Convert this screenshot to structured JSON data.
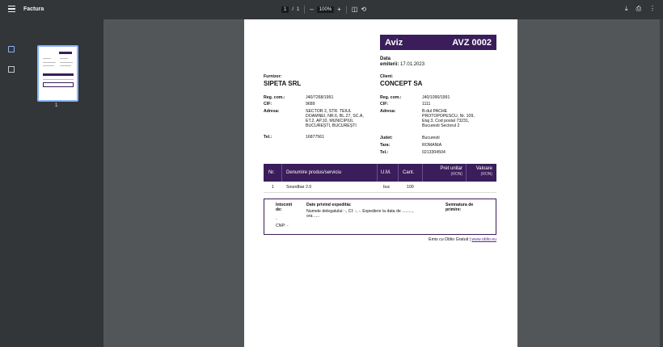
{
  "toolbar": {
    "title": "Factura",
    "page_current": "1",
    "page_separator": "/",
    "page_total": "1",
    "zoom": "100%",
    "zoom_out": "–",
    "zoom_in": "+"
  },
  "sidebar": {
    "thumb_page": "1"
  },
  "doc": {
    "doc_type": "Aviz",
    "doc_number": "AVZ 0002",
    "date_label": "Data",
    "date_label2": "emiterii:",
    "date_value": "17.01.2023",
    "supplier_label": "Furnizor:",
    "supplier_name": "SIPETA SRL",
    "client_label": "Client:",
    "client_name": "CONCEPT SA",
    "supplier": {
      "reg_label": "Reg. com.:",
      "reg": "J40/7268/1991",
      "cif_label": "CIF:",
      "cif": "9689",
      "addr_label": "Adresa:",
      "addr1": "SECTOR 2, STR. TEIUL",
      "addr2": "DOAMNEI, NR.6, BL.27, SC.A,",
      "addr3": "ET.2, AP.10, MUNICIPIUL",
      "addr4": "BUCUREȘTI, BUCUREȘTI",
      "tel_label": "Tel.:",
      "tel": "16877561"
    },
    "client": {
      "reg_label": "Reg. com.:",
      "reg": "J40/1090/1991",
      "cif_label": "CIF:",
      "cif": "1111",
      "addr_label": "Adresa:",
      "addr1": "B-dul PACHE",
      "addr2": "PROTOPOPESCU, Nr. 109,",
      "addr3": "Etaj 3, Cod postal 73231,",
      "addr4": "Bucuresti Sectorul 2",
      "county_label": "Judet:",
      "county": "Bucuresti",
      "country_label": "Tara:",
      "country": "ROMANIA",
      "tel_label": "Tel.:",
      "tel": "0213304504"
    },
    "table": {
      "h_nr": "Nr.",
      "h_name": "Denumire produs/serviciu",
      "h_um": "U.M.",
      "h_qty": "Cant.",
      "h_price": "Pret unitar",
      "h_price_sub": "(RON)",
      "h_value": "Valoare",
      "h_value_sub": "(RON)",
      "rows": [
        {
          "nr": "1",
          "name": "Soundbar 2.0",
          "um": "buc",
          "qty": "100"
        }
      ]
    },
    "expedition": {
      "made_label1": "Intocmit",
      "made_label2": "de:",
      "made_dash": "-",
      "cnp": "CNP: -",
      "data_label": "Date privind expeditia:",
      "data_line1": "Numele delegatului: -, CI: -, -. Expediere la data de .........,",
      "data_line2": "ora .....",
      "sign_label1": "Semnatura de",
      "sign_label2": "primire:"
    },
    "footer_text": "Emis cu Oblio Gratuit |",
    "footer_link": "www.oblio.eu"
  }
}
